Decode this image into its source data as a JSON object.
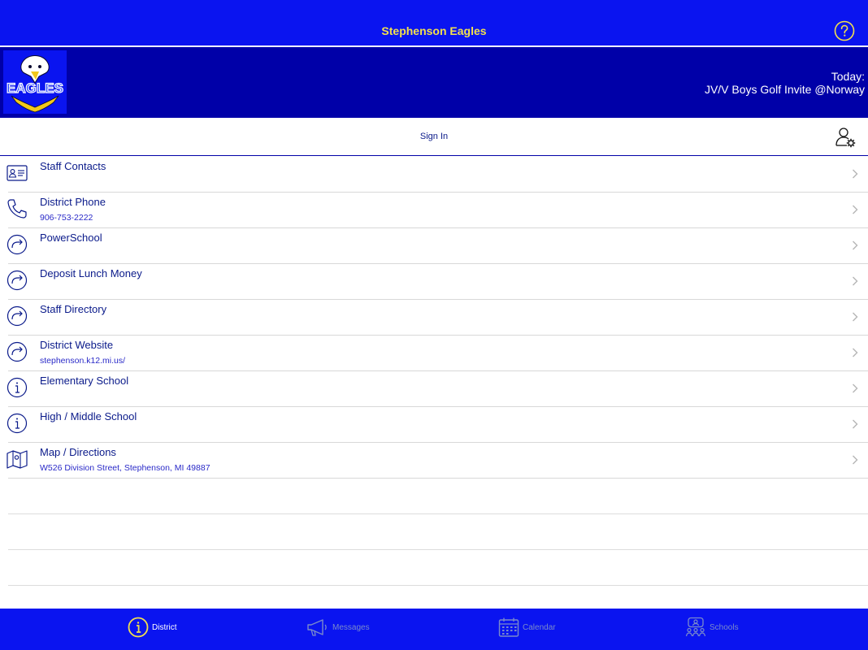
{
  "header": {
    "title": "Stephenson Eagles",
    "help_icon": "help-circle-icon"
  },
  "banner": {
    "logo_icon": "eagles-logo",
    "logo_text": "EAGLES",
    "today_label": "Today:",
    "today_event": "JV/V Boys Golf Invite @Norway"
  },
  "signin": {
    "label": "Sign In",
    "settings_icon": "user-settings-icon"
  },
  "colors": {
    "header_bg": "#0a14f0",
    "banner_bg": "#0000a8",
    "title_color": "#f2e04d",
    "link_color": "#2a2ac8"
  },
  "list": [
    {
      "icon": "contact-card-icon",
      "label": "Staff Contacts",
      "sub": ""
    },
    {
      "icon": "phone-icon",
      "label": "District Phone",
      "sub": "906-753-2222"
    },
    {
      "icon": "redirect-icon",
      "label": "PowerSchool",
      "sub": ""
    },
    {
      "icon": "redirect-icon",
      "label": "Deposit Lunch Money",
      "sub": ""
    },
    {
      "icon": "redirect-icon",
      "label": "Staff Directory",
      "sub": ""
    },
    {
      "icon": "redirect-icon",
      "label": "District Website",
      "sub": "stephenson.k12.mi.us/"
    },
    {
      "icon": "info-icon",
      "label": "Elementary School",
      "sub": ""
    },
    {
      "icon": "info-icon",
      "label": "High / Middle School",
      "sub": ""
    },
    {
      "icon": "map-icon",
      "label": "Map / Directions",
      "sub": "W526 Division Street, Stephenson, MI 49887"
    }
  ],
  "tabs": [
    {
      "icon": "info-circle-icon",
      "label": "District",
      "active": true
    },
    {
      "icon": "megaphone-icon",
      "label": "Messages",
      "active": false
    },
    {
      "icon": "calendar-icon",
      "label": "Calendar",
      "active": false
    },
    {
      "icon": "schools-group-icon",
      "label": "Schools",
      "active": false
    }
  ]
}
